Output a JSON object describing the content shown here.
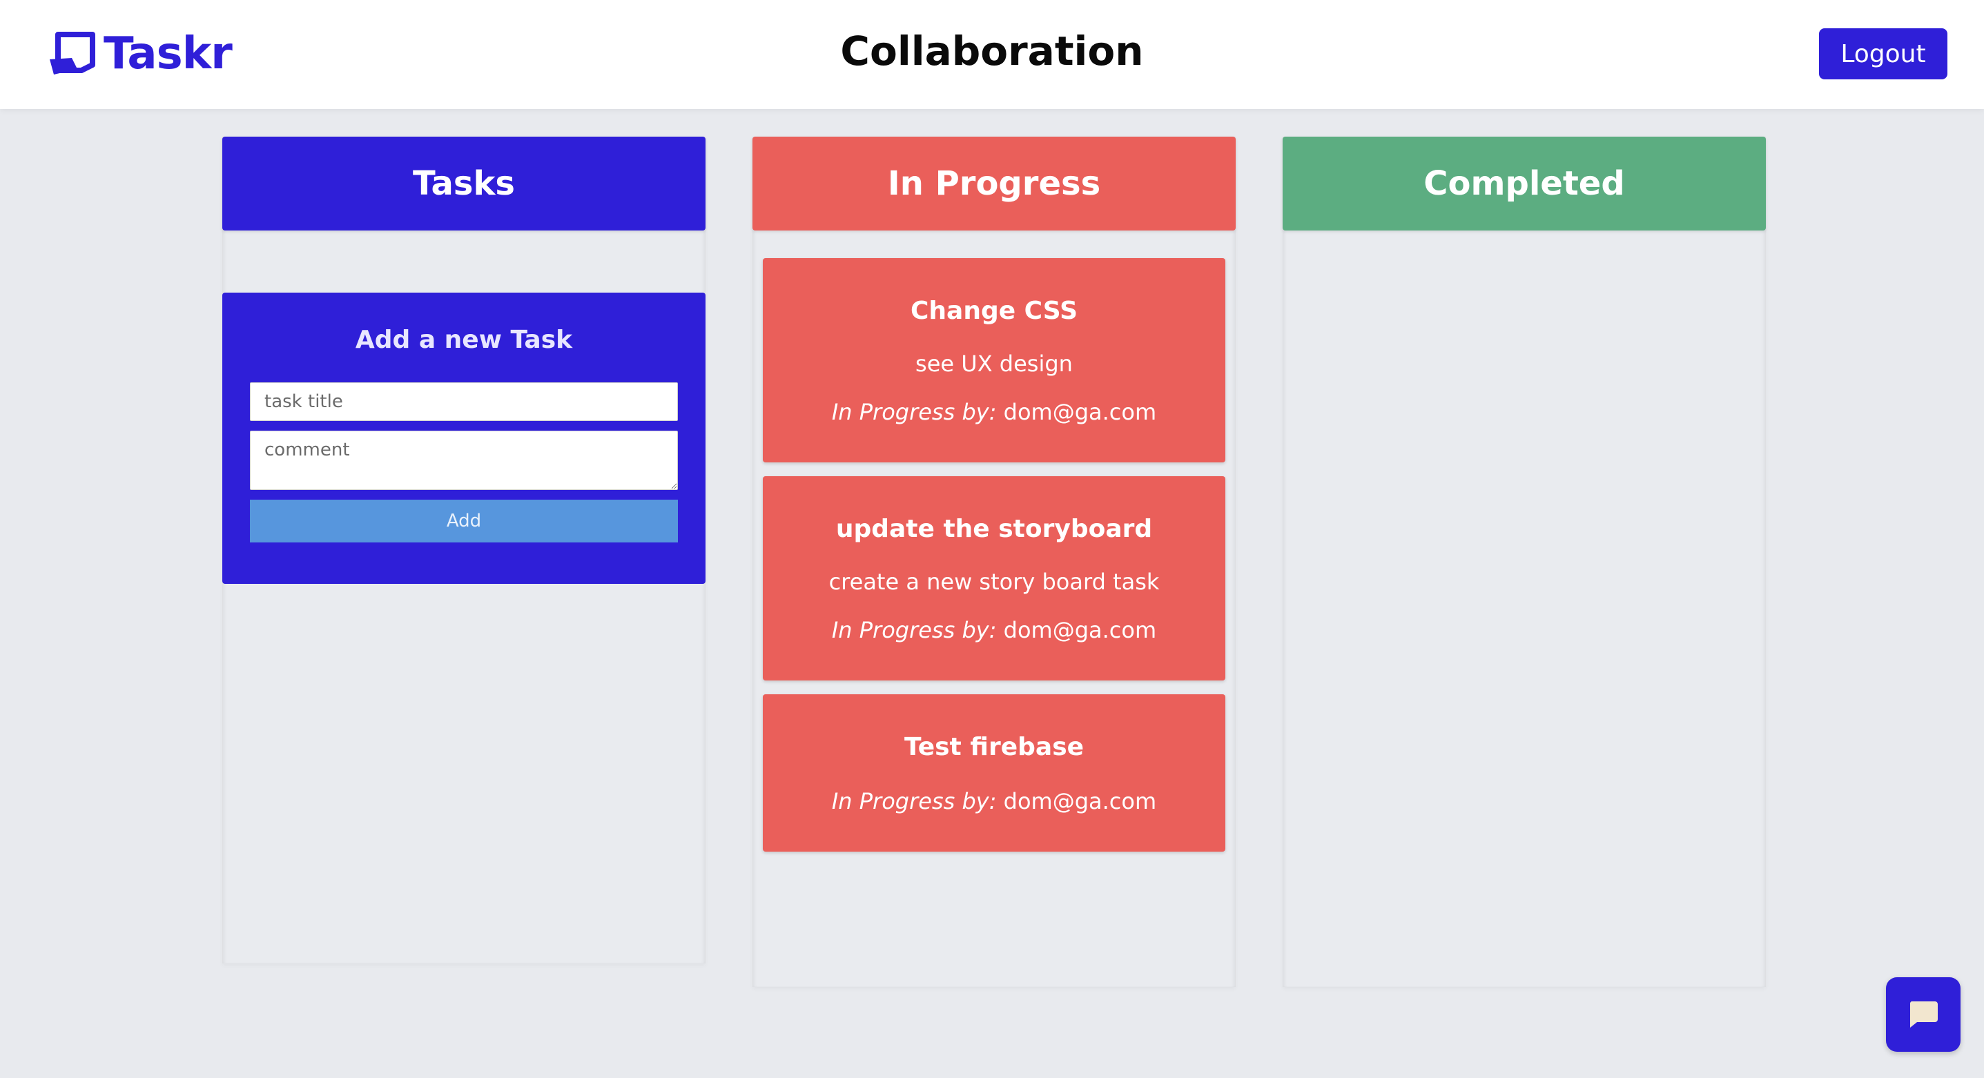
{
  "header": {
    "logo_text": "Taskr",
    "page_title": "Collaboration",
    "logout_label": "Logout"
  },
  "columns": [
    {
      "title": "Tasks",
      "color": "#2f1fd8"
    },
    {
      "title": "In Progress",
      "color": "#ea5f5a"
    },
    {
      "title": "Completed",
      "color": "#5cad81"
    }
  ],
  "add_task": {
    "title": "Add a new Task",
    "title_placeholder": "task title",
    "comment_placeholder": "comment",
    "add_label": "Add"
  },
  "in_progress_cards": [
    {
      "title": "Change CSS",
      "comment": "see UX design",
      "by_label": "In Progress by:",
      "by_user": "dom@ga.com"
    },
    {
      "title": "update the storyboard",
      "comment": "create a new story board task",
      "by_label": "In Progress by:",
      "by_user": "dom@ga.com"
    },
    {
      "title": "Test firebase",
      "by_label": "In Progress by:",
      "by_user": "dom@ga.com"
    }
  ],
  "chat": {
    "icon": "chat-bubble-icon"
  }
}
